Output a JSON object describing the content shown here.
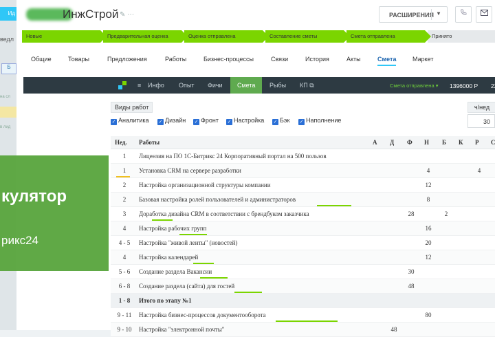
{
  "left_panel": {
    "tab_label": "Ид",
    "text1": "ведл",
    "box_label": "Б",
    "small1": "на сл",
    "small2": "в лид"
  },
  "header": {
    "title": "ИнжСтрой",
    "title_icons": "✎ ⋯",
    "extensions_label": "РАСШИРЕНИЯ",
    "caret": "▾",
    "phone_icon": "phone-icon",
    "mail_icon": "mail-icon"
  },
  "stages": [
    "Новые",
    "Предварительная оценка",
    "Оценка отправлена",
    "Составление сметы",
    "Смета отправлена",
    "Принято"
  ],
  "tabs": [
    "Общие",
    "Товары",
    "Предложения",
    "Работы",
    "Бизнес-процессы",
    "Связи",
    "История",
    "Акты",
    "Смета",
    "Маркет"
  ],
  "dark_bar": {
    "menu": "≡",
    "items": [
      "Инфо",
      "Опыт",
      "Фичи",
      "Смета",
      "Рыбы",
      "КП ⧉"
    ],
    "status": "Смета отправлена ▾",
    "price": "1396000 Р",
    "more": "22"
  },
  "filters": {
    "work_types_label": "Виды работ",
    "checkboxes": [
      "Аналитика",
      "Дизайн",
      "Фронт",
      "Настройка",
      "Бэк",
      "Наполнение"
    ],
    "check_glyph": "✓",
    "hours_per_week_label": "ч/нед",
    "hours_per_week_value": "30"
  },
  "table": {
    "headers": {
      "week": "Нед.",
      "work": "Работы",
      "a": "А",
      "d": "Д",
      "f": "Ф",
      "n": "Н",
      "b": "Б",
      "k": "К",
      "r": "Р",
      "s": "С"
    },
    "rows": [
      {
        "week": "1",
        "work": "Лицензия на ПО 1С-Битрикс 24 Корпоративный портал на 500 пользов",
        "a": "",
        "d": "",
        "f": "",
        "n": "",
        "b": "",
        "k": "",
        "r": ""
      },
      {
        "week": "1",
        "work": "Установка CRM на сервере разработки",
        "a": "",
        "d": "",
        "f": "",
        "n": "4",
        "b": "",
        "k": "",
        "r": "4"
      },
      {
        "week": "2",
        "work": "Настройка организационной структуры компании",
        "a": "",
        "d": "",
        "f": "",
        "n": "12",
        "b": "",
        "k": "",
        "r": ""
      },
      {
        "week": "2",
        "work": "Базовая настройка ролей пользователей и администраторов",
        "a": "",
        "d": "",
        "f": "",
        "n": "8",
        "b": "",
        "k": "",
        "r": ""
      },
      {
        "week": "3",
        "work": "Доработка дизайна CRM в соответствии с брендбуком заказчика",
        "a": "",
        "d": "",
        "f": "28",
        "n": "",
        "b": "2",
        "k": "",
        "r": ""
      },
      {
        "week": "4",
        "work": "Настройка рабочих групп",
        "a": "",
        "d": "",
        "f": "",
        "n": "16",
        "b": "",
        "k": "",
        "r": ""
      },
      {
        "week": "4 - 5",
        "work": "Настройка \"живой ленты\" (новостей)",
        "a": "",
        "d": "",
        "f": "",
        "n": "20",
        "b": "",
        "k": "",
        "r": ""
      },
      {
        "week": "4",
        "work": "Настройка календарей",
        "a": "",
        "d": "",
        "f": "",
        "n": "12",
        "b": "",
        "k": "",
        "r": ""
      },
      {
        "week": "5 - 6",
        "work": "Создание раздела Вакансии",
        "a": "",
        "d": "",
        "f": "30",
        "n": "",
        "b": "",
        "k": "",
        "r": ""
      },
      {
        "week": "6 - 8",
        "work": "Создание раздела (сайта) для гостей",
        "a": "",
        "d": "",
        "f": "48",
        "n": "",
        "b": "",
        "k": "",
        "r": ""
      },
      {
        "week": "1 - 8",
        "work": "Итого по этапу №1",
        "a": "",
        "d": "",
        "f": "",
        "n": "",
        "b": "",
        "k": "",
        "r": ""
      },
      {
        "week": "9 - 11",
        "work": "Настройка бизнес-процессов документооборота",
        "a": "",
        "d": "",
        "f": "",
        "n": "80",
        "b": "",
        "k": "",
        "r": ""
      },
      {
        "week": "9 - 10",
        "work": "Настройка \"электронной почты\"",
        "a": "",
        "d": "48",
        "f": "",
        "n": "",
        "b": "",
        "k": "",
        "r": ""
      }
    ]
  },
  "overlay": {
    "line1": "кулятор",
    "line2": "рикс24"
  },
  "colors": {
    "accent_green": "#7bd500",
    "dark_bar": "#2d3a42",
    "active_tab": "#2067b0",
    "overlay": "#5aa53e"
  }
}
